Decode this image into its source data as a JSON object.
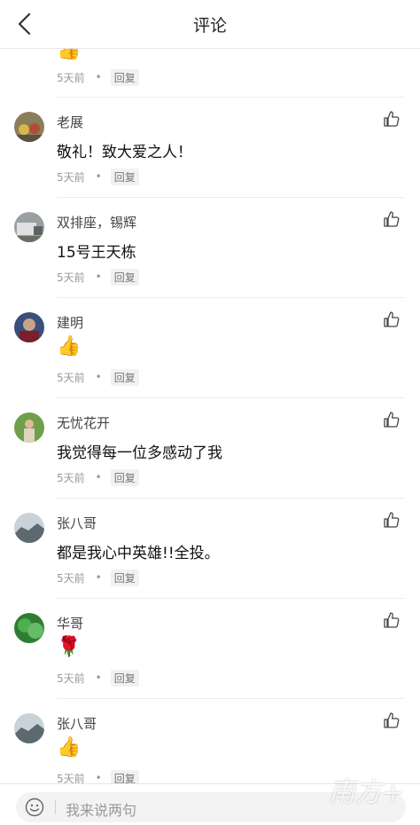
{
  "header": {
    "title": "评论",
    "back_icon": "chevron-left-icon"
  },
  "top_partial": {
    "content": "👍",
    "time": "5天前",
    "dot": "•",
    "reply": "回复"
  },
  "comments": [
    {
      "name": "老展",
      "content": "敬礼！致大爱之人！",
      "time": "5天前",
      "dot": "•",
      "reply": "回复"
    },
    {
      "name": "双排座，锡辉",
      "content": "15号王天栋",
      "time": "5天前",
      "dot": "•",
      "reply": "回复"
    },
    {
      "name": "建明",
      "content": "👍",
      "time": "5天前",
      "dot": "•",
      "reply": "回复"
    },
    {
      "name": "无忧花开",
      "content": "我觉得每一位多感动了我",
      "time": "5天前",
      "dot": "•",
      "reply": "回复"
    },
    {
      "name": "张八哥",
      "content": "都是我心中英雄!!全投。",
      "time": "5天前",
      "dot": "•",
      "reply": "回复"
    },
    {
      "name": "华哥",
      "content": "🌹",
      "time": "5天前",
      "dot": "•",
      "reply": "回复"
    },
    {
      "name": "张八哥",
      "content": "👍",
      "time": "5天前",
      "dot": "•",
      "reply": "回复"
    }
  ],
  "footer": {
    "placeholder": "我来说两句",
    "emoji_icon": "smile-icon"
  },
  "watermark": "南方+",
  "colors": {
    "accent_text": "#222222",
    "meta_text": "#999999",
    "reply_bg": "#f1f1f1"
  }
}
